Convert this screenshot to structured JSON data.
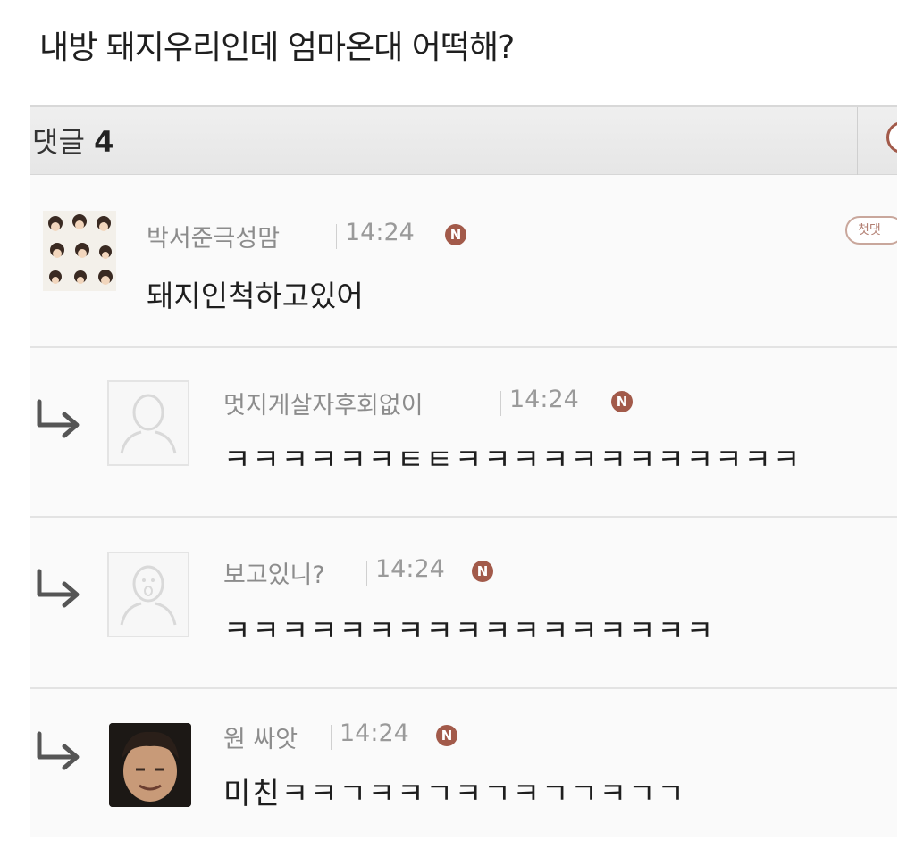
{
  "post": {
    "title": "내방 돼지우리인데 엄마온대 어떡해?"
  },
  "comments_header": {
    "label": "댓글",
    "count": "4"
  },
  "comments": [
    {
      "author": "박서준극성맘",
      "time": "14:24",
      "new_badge": "N",
      "text": "돼지인척하고있어",
      "badge": "첫댓"
    },
    {
      "author": "멋지게살자후회없이",
      "time": "14:24",
      "new_badge": "N",
      "text": "ㅋㅋㅋㅋㅋㅋㅌㅌㅋㅋㅋㅋㅋㅋㅋㅋㅋㅋㅋㅋ"
    },
    {
      "author": "보고있니?",
      "time": "14:24",
      "new_badge": "N",
      "text": "ㅋㅋㅋㅋㅋㅋㅋㅋㅋㅋㅋㅋㅋㅋㅋㅋㅋ"
    },
    {
      "author": "원 싸앗",
      "time": "14:24",
      "new_badge": "N",
      "text": "미친ㅋㅋㄱㅋㅋㄱㅋㄱㅋㄱㄱㅋㄱㄱ"
    }
  ],
  "colors": {
    "accent": "#a25a4a",
    "meta_text": "#8c8c8c",
    "body_text": "#1e1e1e"
  },
  "icons": {
    "reply": "reply-arrow-icon",
    "default_avatar": "person-silhouette-icon",
    "new": "new-badge-icon"
  }
}
